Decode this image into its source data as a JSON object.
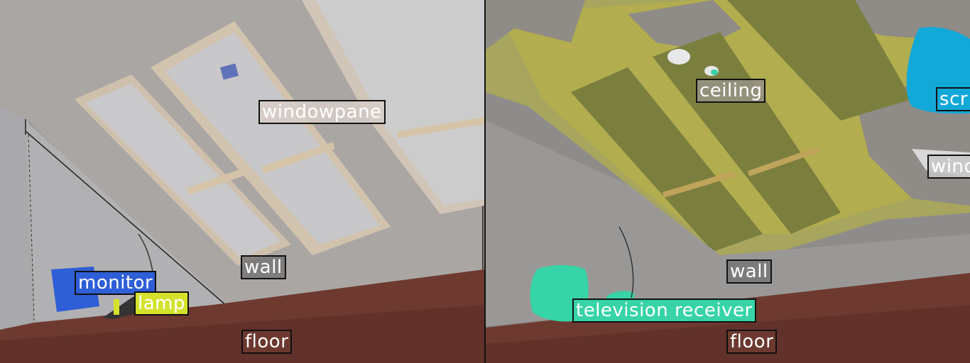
{
  "left_panel": {
    "labels": {
      "windowpane": "windowpane",
      "monitor": "monitor",
      "lamp": "lamp",
      "wall": "wall",
      "floor": "floor"
    }
  },
  "right_panel": {
    "labels": {
      "ceiling": "ceiling",
      "screen": "scr",
      "window": "wind",
      "wall": "wall",
      "television_receiver": "television receiver",
      "floor": "floor"
    }
  },
  "colors": {
    "monitor": "#2f5fd6",
    "lamp": "#d4e22c",
    "television_receiver": "#36d4a6",
    "screen": "#12a8d8",
    "ceiling_overlay": "#b4b03c",
    "floor": "#6e3a30"
  }
}
